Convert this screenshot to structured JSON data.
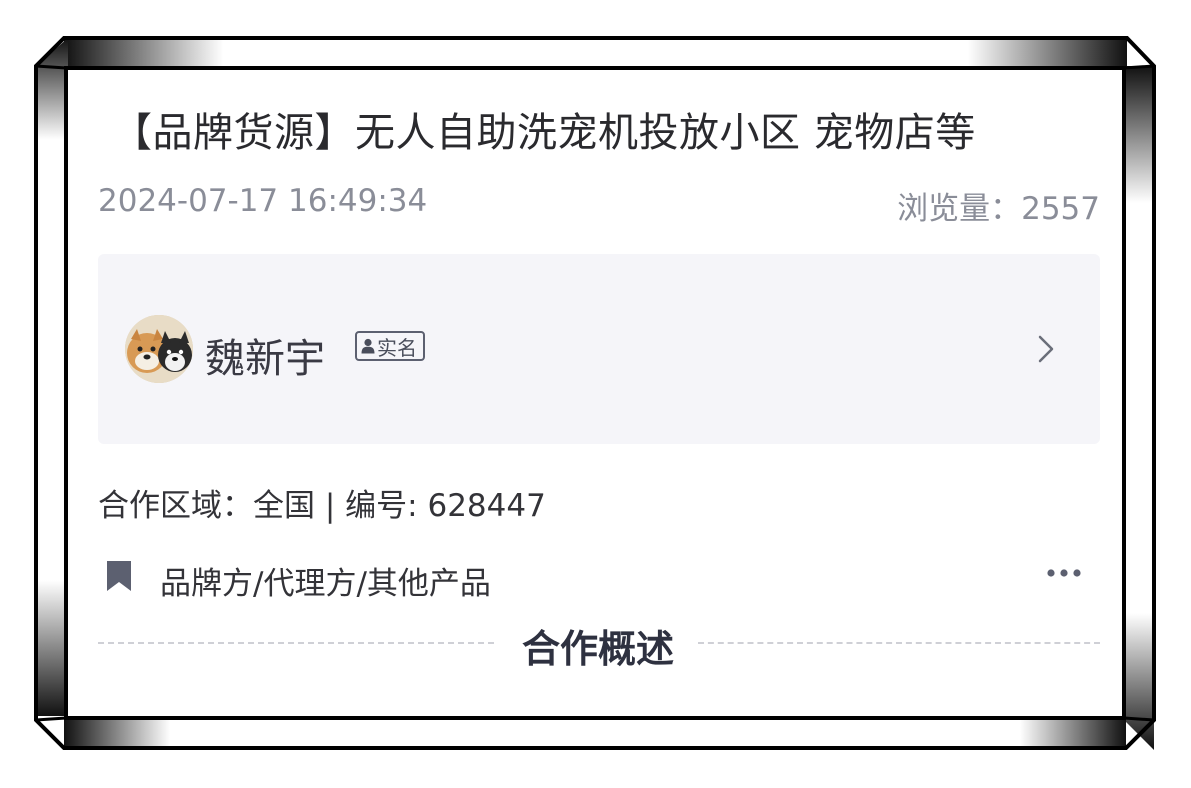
{
  "post": {
    "title": "【品牌货源】无人自助洗宠机投放小区 宠物店等",
    "date": "2024-07-17 16:49:34",
    "views_label": "浏览量：",
    "views": "2557"
  },
  "author": {
    "name": "魏新宇",
    "badge": "实名",
    "badge_icon": "person-icon",
    "chevron_icon": "chevron-right-icon"
  },
  "info": {
    "region_label": "合作区域：",
    "region": "全国",
    "separator": " | ",
    "number_label": "编号: ",
    "number": "628447"
  },
  "category": {
    "icon": "bookmark-icon",
    "label": "品牌方/代理方/其他产品",
    "more_icon": "more-dots-icon"
  },
  "section": {
    "title": "合作概述"
  },
  "colors": {
    "text_primary": "#2a2a2e",
    "text_secondary": "#8a8d98",
    "card_bg": "#f5f5f9",
    "icon": "#5c6070"
  }
}
